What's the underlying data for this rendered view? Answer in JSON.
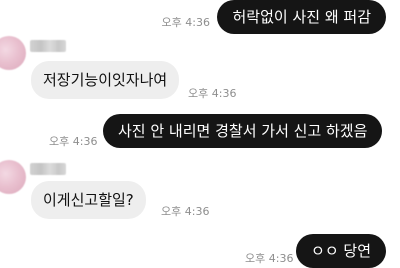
{
  "messages": [
    {
      "direction": "out",
      "text": "허락없이 사진 왜 퍼감",
      "time": "오후 4:36"
    },
    {
      "direction": "in",
      "text": "저장기능이잇자나여",
      "time": "오후 4:36"
    },
    {
      "direction": "out",
      "text": "사진 안 내리면 경찰서 가서 신고 하겠음",
      "time": "오후 4:36"
    },
    {
      "direction": "in",
      "text": "이게신고할일?",
      "time": "오후 4:36"
    },
    {
      "direction": "out",
      "text": "ㅇㅇ 당연",
      "time": "오후 4:36"
    }
  ],
  "colors": {
    "outgoing_bubble": "#151515",
    "incoming_bubble": "#eeeeee",
    "timestamp": "#8e8e8e"
  },
  "icons": [
    "avatar-blurred",
    "sender-name-blurred"
  ]
}
